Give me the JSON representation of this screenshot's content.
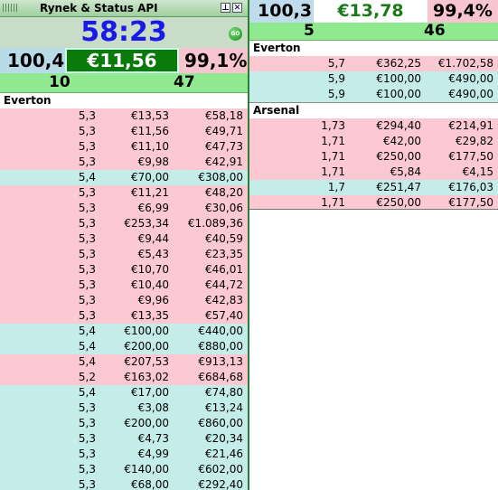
{
  "window": {
    "title": "Rynek & Status API"
  },
  "left": {
    "timer": "58:23",
    "go_label": "GO",
    "summary": {
      "odds": "100,4",
      "amount": "€11,56",
      "percent": "99,1%",
      "count_a": "10",
      "count_b": "47"
    },
    "group": "Everton",
    "rows": [
      {
        "odds": "5,3",
        "stake": "€13,53",
        "total": "€58,18",
        "type": "lay"
      },
      {
        "odds": "5,3",
        "stake": "€11,56",
        "total": "€49,71",
        "type": "lay"
      },
      {
        "odds": "5,3",
        "stake": "€11,10",
        "total": "€47,73",
        "type": "lay"
      },
      {
        "odds": "5,3",
        "stake": "€9,98",
        "total": "€42,91",
        "type": "lay"
      },
      {
        "odds": "5,4",
        "stake": "€70,00",
        "total": "€308,00",
        "type": "back"
      },
      {
        "odds": "5,3",
        "stake": "€11,21",
        "total": "€48,20",
        "type": "lay"
      },
      {
        "odds": "5,3",
        "stake": "€6,99",
        "total": "€30,06",
        "type": "lay"
      },
      {
        "odds": "5,3",
        "stake": "€253,34",
        "total": "€1.089,36",
        "type": "lay"
      },
      {
        "odds": "5,3",
        "stake": "€9,44",
        "total": "€40,59",
        "type": "lay"
      },
      {
        "odds": "5,3",
        "stake": "€5,43",
        "total": "€23,35",
        "type": "lay"
      },
      {
        "odds": "5,3",
        "stake": "€10,70",
        "total": "€46,01",
        "type": "lay"
      },
      {
        "odds": "5,3",
        "stake": "€10,40",
        "total": "€44,72",
        "type": "lay"
      },
      {
        "odds": "5,3",
        "stake": "€9,96",
        "total": "€42,83",
        "type": "lay"
      },
      {
        "odds": "5,3",
        "stake": "€13,35",
        "total": "€57,40",
        "type": "lay"
      },
      {
        "odds": "5,4",
        "stake": "€100,00",
        "total": "€440,00",
        "type": "back"
      },
      {
        "odds": "5,4",
        "stake": "€200,00",
        "total": "€880,00",
        "type": "back"
      },
      {
        "odds": "5,4",
        "stake": "€207,53",
        "total": "€913,13",
        "type": "lay"
      },
      {
        "odds": "5,2",
        "stake": "€163,02",
        "total": "€684,68",
        "type": "lay"
      },
      {
        "odds": "5,4",
        "stake": "€17,00",
        "total": "€74,80",
        "type": "back"
      },
      {
        "odds": "5,3",
        "stake": "€3,08",
        "total": "€13,24",
        "type": "back"
      },
      {
        "odds": "5,3",
        "stake": "€200,00",
        "total": "€860,00",
        "type": "back"
      },
      {
        "odds": "5,3",
        "stake": "€4,73",
        "total": "€20,34",
        "type": "back"
      },
      {
        "odds": "5,3",
        "stake": "€4,99",
        "total": "€21,46",
        "type": "back"
      },
      {
        "odds": "5,3",
        "stake": "€140,00",
        "total": "€602,00",
        "type": "back"
      },
      {
        "odds": "5,3",
        "stake": "€68,00",
        "total": "€292,40",
        "type": "back"
      }
    ]
  },
  "right": {
    "summary": {
      "odds": "100,3",
      "amount": "€13,78",
      "percent": "99,4%",
      "count_a": "5",
      "count_b": "46"
    },
    "groups": [
      {
        "name": "Everton",
        "rows": [
          {
            "odds": "5,7",
            "stake": "€362,25",
            "total": "€1.702,58",
            "type": "lay"
          },
          {
            "odds": "5,9",
            "stake": "€100,00",
            "total": "€490,00",
            "type": "back"
          },
          {
            "odds": "5,9",
            "stake": "€100,00",
            "total": "€490,00",
            "type": "back"
          }
        ]
      },
      {
        "name": "Arsenal",
        "rows": [
          {
            "odds": "1,73",
            "stake": "€294,40",
            "total": "€214,91",
            "type": "lay"
          },
          {
            "odds": "1,71",
            "stake": "€42,00",
            "total": "€29,82",
            "type": "lay"
          },
          {
            "odds": "1,71",
            "stake": "€250,00",
            "total": "€177,50",
            "type": "lay"
          },
          {
            "odds": "1,71",
            "stake": "€5,84",
            "total": "€4,15",
            "type": "lay"
          },
          {
            "odds": "1,7",
            "stake": "€251,47",
            "total": "€176,03",
            "type": "back"
          },
          {
            "odds": "1,71",
            "stake": "€250,00",
            "total": "€177,50",
            "type": "lay"
          }
        ]
      }
    ]
  },
  "colors": {
    "back": "#c4ece8",
    "lay": "#fcc8d2",
    "accent_green": "#0a7a0a",
    "timer_blue": "#1a1ae6"
  }
}
